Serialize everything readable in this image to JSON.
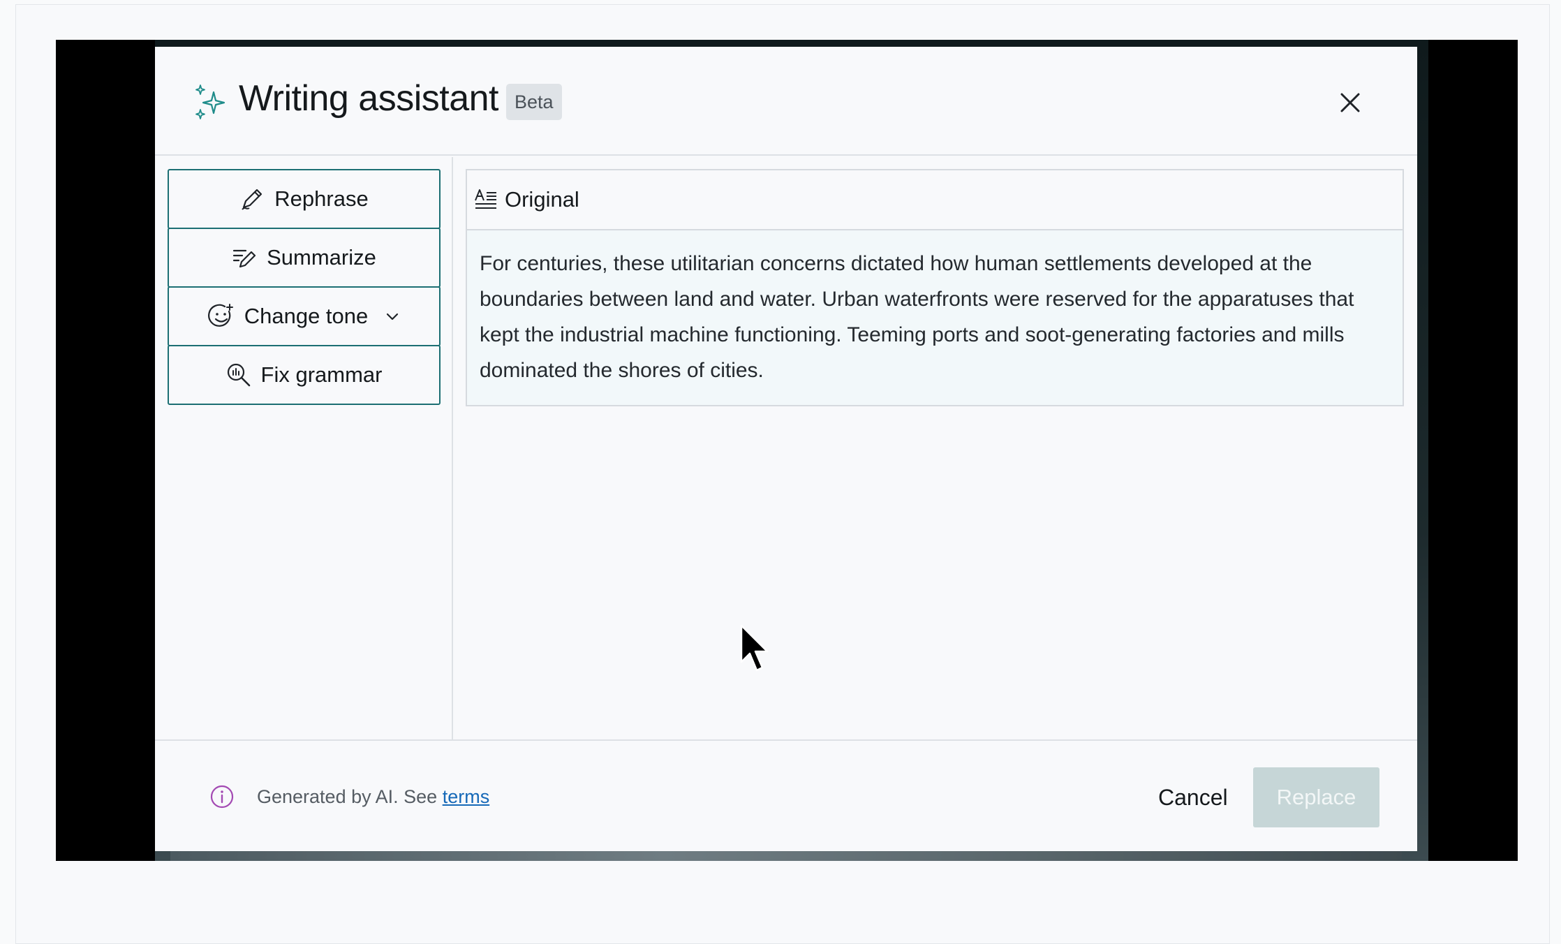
{
  "dialog": {
    "title": "Writing assistant",
    "badge": "Beta",
    "close_icon": "close-icon",
    "accent_color": "#1c6f73"
  },
  "actions": [
    {
      "label": "Rephrase",
      "icon": "pencil-icon"
    },
    {
      "label": "Summarize",
      "icon": "summarize-pencil-icon"
    },
    {
      "label": "Change tone",
      "icon": "smiley-icon",
      "has_dropdown": true
    },
    {
      "label": "Fix grammar",
      "icon": "magnifier-icon"
    }
  ],
  "original": {
    "heading": "Original",
    "icon": "text-format-icon",
    "text": "For centuries, these utilitarian concerns dictated how human settlements developed at the boundaries between land and water. Urban waterfronts were reserved for the apparatuses that kept the industrial machine functioning. Teeming ports and soot-generating factories and mills dominated the shores of cities."
  },
  "footer": {
    "note_prefix": "Generated by AI. See ",
    "note_link": "terms",
    "cancel_label": "Cancel",
    "replace_label": "Replace",
    "replace_disabled": true
  }
}
